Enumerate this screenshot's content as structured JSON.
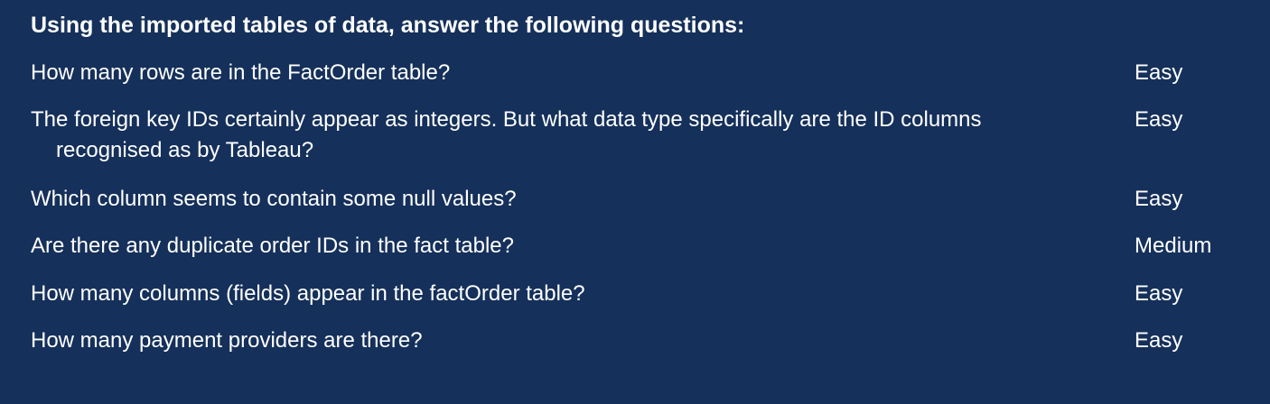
{
  "heading": "Using the imported tables of data, answer the following questions:",
  "colors": {
    "background": "#15305a",
    "text": "#ffffff"
  },
  "questions": [
    {
      "text": "How many rows are in the FactOrder table?",
      "difficulty": "Easy"
    },
    {
      "text": "The foreign key IDs certainly appear as integers. But what data type specifically are the ID columns recognised as by Tableau?",
      "difficulty": "Easy"
    },
    {
      "text": "Which column seems to contain some null values?",
      "difficulty": "Easy"
    },
    {
      "text": "Are there any duplicate order IDs in the fact table?",
      "difficulty": "Medium"
    },
    {
      "text": "How many columns (fields) appear in the factOrder table?",
      "difficulty": "Easy"
    },
    {
      "text": "How many payment providers are there?",
      "difficulty": "Easy"
    }
  ]
}
